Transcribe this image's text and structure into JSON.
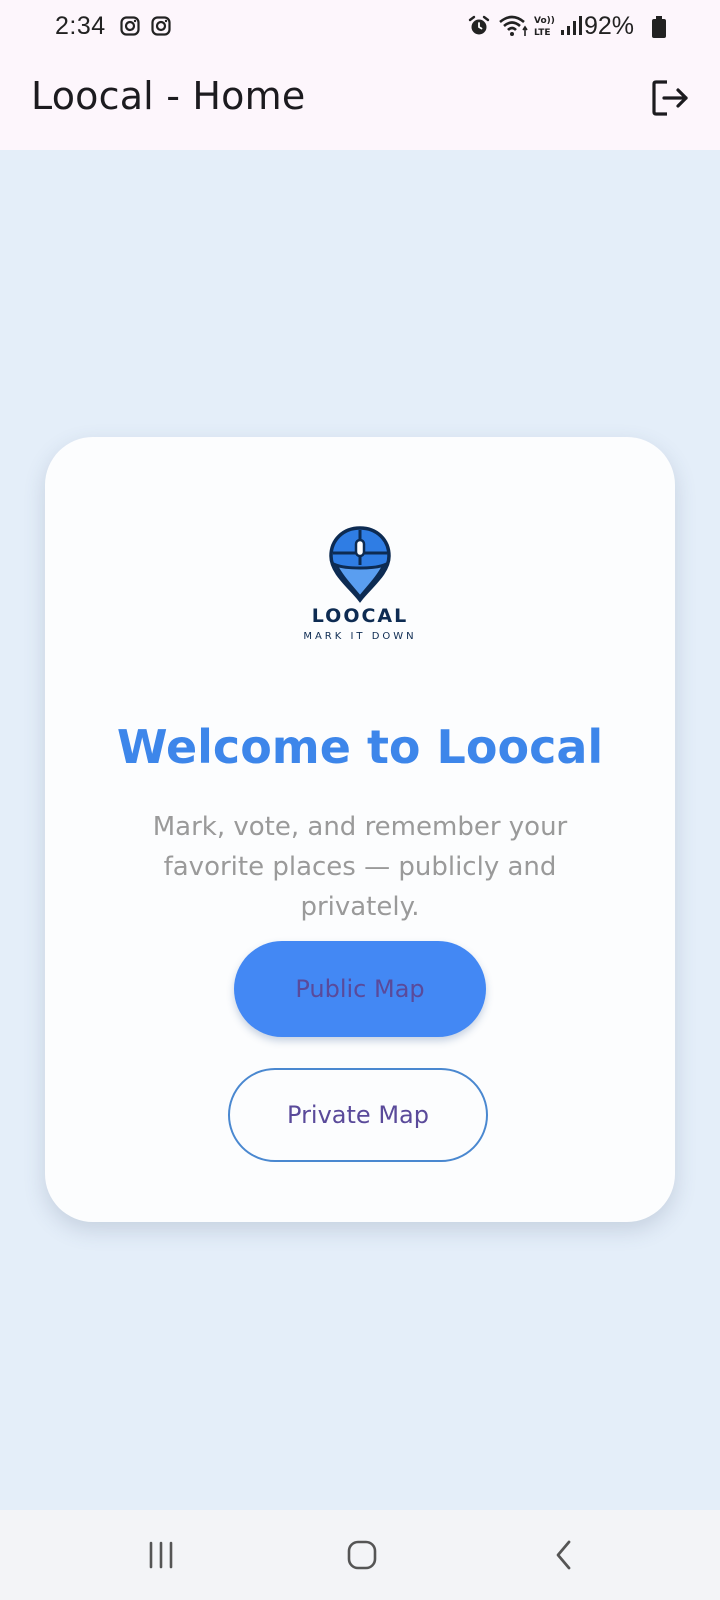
{
  "status_bar": {
    "time": "2:34",
    "battery": "92%",
    "icons": [
      "instagram-icon",
      "instagram-icon",
      "alarm-icon",
      "wifi-icon",
      "volte-icon",
      "signal-icon",
      "battery-icon"
    ]
  },
  "app_bar": {
    "title": "Loocal - Home",
    "logout_icon": "logout-icon"
  },
  "card": {
    "logo": {
      "name": "LOOCAL",
      "tagline": "MARK IT DOWN"
    },
    "welcome": "Welcome to Loocal",
    "subtitle": "Mark, vote, and remember your favorite places — publicly and privately.",
    "public_button": "Public Map",
    "private_button": "Private Map"
  },
  "nav_bar": {
    "icons": [
      "recent-apps-icon",
      "home-icon",
      "back-icon"
    ]
  },
  "colors": {
    "accent": "#3d86ea",
    "primary_button": "#4388f4",
    "button_text": "#5a4a9a",
    "background": "#e4eef9",
    "app_bar": "#fdf6fc"
  }
}
